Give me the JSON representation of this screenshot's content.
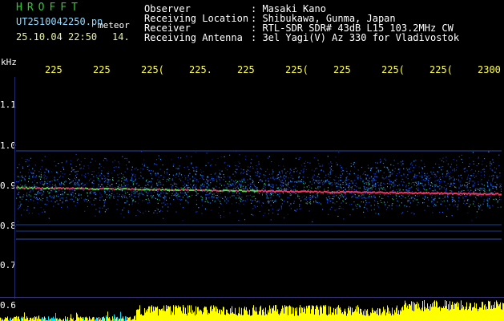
{
  "header": {
    "app_title": "HROFFT",
    "file_name": "UT2510042250.pn",
    "file_suffix": "meteor",
    "date_time": "25.10.04 22:50",
    "observation_number": "14."
  },
  "station": {
    "rows": [
      {
        "label": "Observer",
        "value": ": Masaki Kano"
      },
      {
        "label": "Receiving Location",
        "value": ": Shibukawa, Gunma, Japan"
      },
      {
        "label": "Receiver",
        "value": ": RTL-SDR SDR# 43dB L15 103.2MHz CW"
      },
      {
        "label": "Receiving Antenna",
        "value": ": 3el Yagi(V) Az 330 for Vladivostok"
      }
    ]
  },
  "axes": {
    "y_unit": "kHz",
    "time_ticks": [
      "225",
      "225",
      "225(",
      "225.",
      "225",
      "225(",
      "225",
      "225(",
      "225(",
      "2300"
    ],
    "freq_ticks": [
      "1.1",
      "1.0",
      "0.9",
      "0.8",
      "0.7",
      "0.6"
    ]
  },
  "colors": {
    "background": "#000000",
    "title_green": "#2ecc2e",
    "file_blue": "#8fd8ff",
    "date_yellow": "#e6f0a0",
    "tick_yellow": "#ffff40",
    "signal_red": "#ff3060",
    "noise_blue": "#1848d8",
    "amplitude_yellow": "#ffff00",
    "amplitude_cyan": "#00e0ff"
  }
}
